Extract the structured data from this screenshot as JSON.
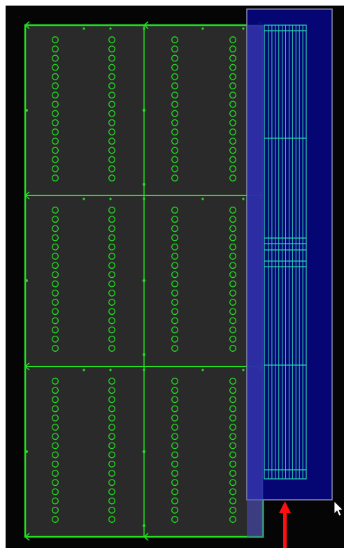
{
  "canvas": {
    "background_color": "#050505",
    "board_fill_color": "#2a2a2a",
    "board_outline_color": "#20e020",
    "highlight_fill_color": "#060680",
    "highlight_border_color": "#8a8ab0",
    "connector_line_color": "#2bdcb6",
    "arrow_color": "#ff1010"
  },
  "board": {
    "panels_count": 3,
    "columns_per_panel": 4,
    "holes_per_column": 16
  },
  "overlay": {
    "name": "selection-highlight",
    "connector_lines_count": 12
  },
  "markers": {
    "bottom_arrow": "red-up-arrow-icon",
    "cursor": "mouse-pointer-icon"
  }
}
